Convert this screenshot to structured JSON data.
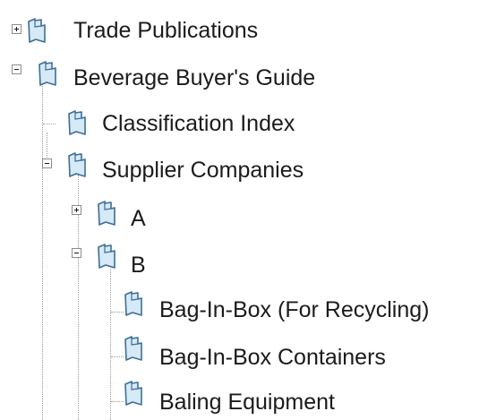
{
  "tree": {
    "items": [
      {
        "label": "Trade Publications",
        "expanded": false,
        "icon": "bookmark-icon"
      },
      {
        "label": "Beverage Buyer's Guide",
        "expanded": true,
        "icon": "bookmark-icon"
      },
      {
        "label": "Classification Index",
        "icon": "bookmark-icon"
      },
      {
        "label": "Supplier Companies",
        "expanded": true,
        "icon": "bookmark-icon"
      },
      {
        "label": "A",
        "expanded": false,
        "icon": "bookmark-icon"
      },
      {
        "label": "B",
        "expanded": true,
        "icon": "bookmark-icon"
      },
      {
        "label": "Bag-In-Box (For Recycling)",
        "icon": "bookmark-icon"
      },
      {
        "label": "Bag-In-Box Containers",
        "icon": "bookmark-icon"
      },
      {
        "label": "Baling Equipment",
        "icon": "bookmark-icon"
      }
    ]
  },
  "colors": {
    "bookmark_fill": "#d6e9f7",
    "bookmark_stroke": "#3d6e95",
    "guide_line": "#9a9a9a",
    "text": "#1b1b1b"
  }
}
